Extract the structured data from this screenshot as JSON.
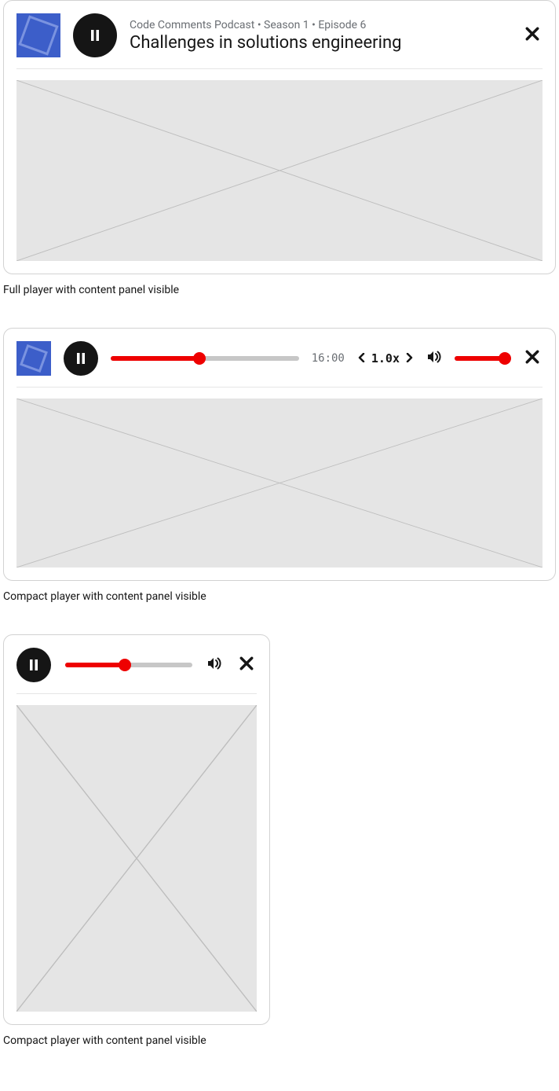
{
  "colors": {
    "accent": "#ee0000",
    "track": "#c7c7c7",
    "dark": "#151515",
    "muted": "#6a6e73"
  },
  "full": {
    "meta": "Code Comments Podcast • Season 1 • Episode 6",
    "title": "Challenges in solutions engineering",
    "caption": "Full player with content panel visible"
  },
  "compactWide": {
    "progressPct": 47,
    "duration": "16:00",
    "speed": "1.0x",
    "volumePct": 92,
    "caption": "Compact player with content panel visible"
  },
  "compactSmall": {
    "progressPct": 47,
    "caption": "Compact player with content panel visible"
  }
}
